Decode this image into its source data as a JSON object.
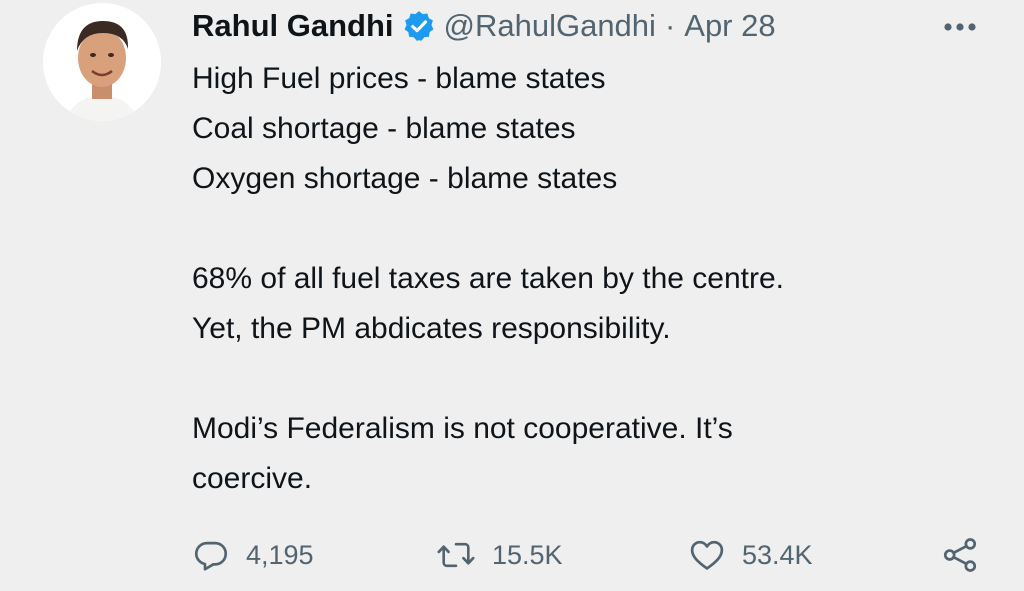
{
  "tweet": {
    "author_name": "Rahul Gandhi",
    "handle": "@RahulGandhi",
    "separator": "·",
    "date": "Apr 28",
    "lines": [
      "High Fuel prices - blame states",
      "Coal shortage - blame states",
      "Oxygen shortage - blame states",
      "",
      "68% of all fuel taxes are taken by the centre.",
      "Yet, the PM abdicates responsibility.",
      "",
      "Modi’s Federalism is not cooperative. It’s",
      "coercive."
    ],
    "replies": "4,195",
    "retweets": "15.5K",
    "likes": "53.4K"
  },
  "icons": {
    "verified": "verified-badge-icon",
    "more": "more-dots-icon",
    "reply": "reply-bubble-icon",
    "retweet": "retweet-icon",
    "like": "heart-icon",
    "share": "share-icon"
  },
  "colors": {
    "background": "#efefef",
    "text": "#0f1419",
    "muted": "#536471",
    "verified": "#1d9bf0"
  }
}
